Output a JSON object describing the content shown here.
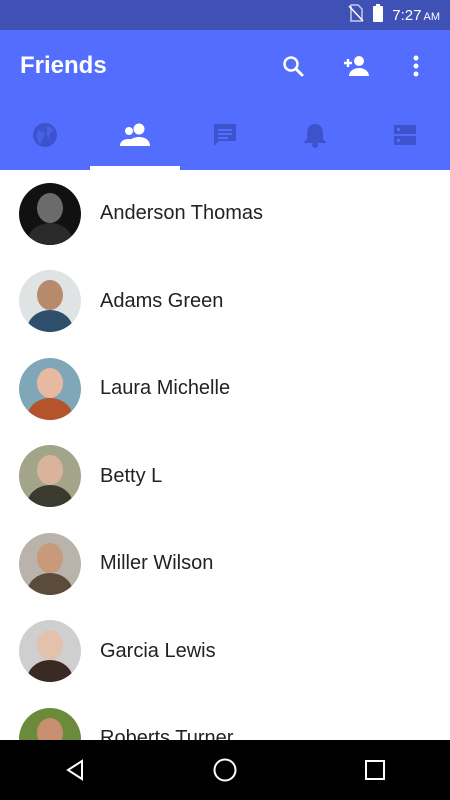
{
  "status_bar": {
    "time": "7:27",
    "ampm": "AM"
  },
  "app_bar": {
    "title": "Friends"
  },
  "tabs": [
    {
      "icon": "globe-icon",
      "active": false
    },
    {
      "icon": "people-icon",
      "active": true
    },
    {
      "icon": "chat-icon",
      "active": false
    },
    {
      "icon": "bell-icon",
      "active": false
    },
    {
      "icon": "server-icon",
      "active": false
    }
  ],
  "friends": [
    {
      "name": "Anderson Thomas"
    },
    {
      "name": "Adams Green"
    },
    {
      "name": "Laura Michelle"
    },
    {
      "name": "Betty L"
    },
    {
      "name": "Miller Wilson"
    },
    {
      "name": "Garcia Lewis"
    },
    {
      "name": "Roberts Turner"
    }
  ],
  "colors": {
    "status_bar": "#3f51b5",
    "app_bar": "#536dfe",
    "text": "#222222"
  }
}
